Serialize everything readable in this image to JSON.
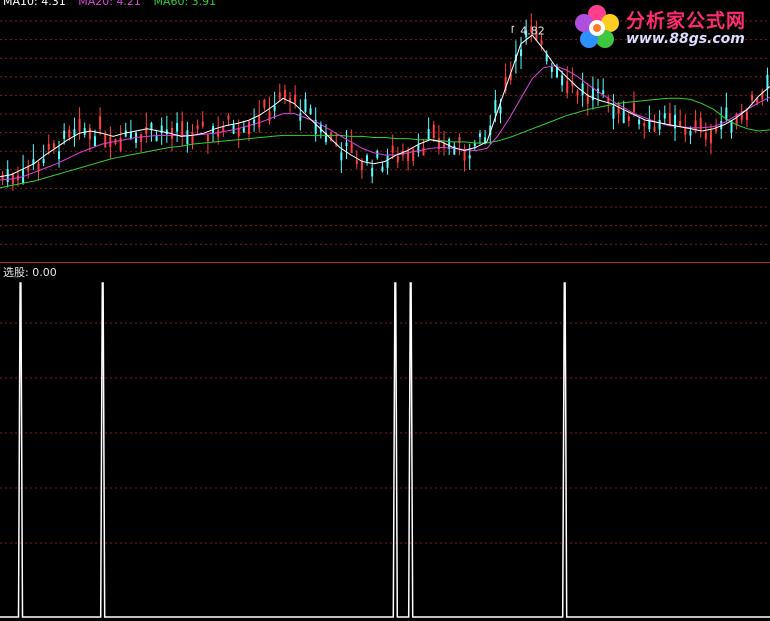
{
  "legend": {
    "ma10_label": "MA10: 4.31",
    "ma20_label": "MA20: 4.21",
    "ma60_label": "MA60: 3.91"
  },
  "colors": {
    "ma10": "#ffffff",
    "ma20": "#e040e0",
    "ma60": "#30d030",
    "candle_up": "#ff4040",
    "candle_down": "#54ffff",
    "grid": "#8a1a1a",
    "divider": "#c02020",
    "signal": "#ffffff"
  },
  "watermark": {
    "title": "分析家公式网",
    "url": "www.88gs.com"
  },
  "chart_data": [
    {
      "type": "candlestick",
      "title": "",
      "annotations": [
        {
          "text": "4.82",
          "label": "high"
        }
      ],
      "y_range": [
        2.9,
        4.9
      ],
      "grid": true,
      "series": [
        {
          "name": "MA10",
          "values": [
            3.48,
            3.5,
            3.55,
            3.6,
            3.68,
            3.75,
            3.82,
            3.88,
            3.9,
            3.88,
            3.85,
            3.88,
            3.9,
            3.92,
            3.9,
            3.88,
            3.85,
            3.86,
            3.88,
            3.92,
            3.95,
            3.97,
            4.0,
            4.05,
            4.12,
            4.2,
            4.15,
            4.05,
            3.95,
            3.85,
            3.75,
            3.68,
            3.62,
            3.6,
            3.62,
            3.68,
            3.72,
            3.78,
            3.82,
            3.8,
            3.75,
            3.72,
            3.75,
            3.8,
            4.1,
            4.4,
            4.7,
            4.78,
            4.65,
            4.5,
            4.4,
            4.3,
            4.22,
            4.18,
            4.15,
            4.1,
            4.05,
            4.0,
            3.98,
            3.96,
            3.94,
            3.92,
            3.9,
            3.92,
            3.96,
            4.02,
            4.1,
            4.22,
            4.31
          ]
        },
        {
          "name": "MA20",
          "values": [
            3.45,
            3.46,
            3.48,
            3.52,
            3.56,
            3.6,
            3.65,
            3.7,
            3.74,
            3.78,
            3.8,
            3.82,
            3.84,
            3.85,
            3.86,
            3.86,
            3.86,
            3.86,
            3.87,
            3.88,
            3.9,
            3.92,
            3.95,
            3.98,
            4.02,
            4.06,
            4.06,
            4.02,
            3.98,
            3.92,
            3.86,
            3.8,
            3.74,
            3.7,
            3.68,
            3.68,
            3.7,
            3.72,
            3.74,
            3.75,
            3.74,
            3.73,
            3.72,
            3.74,
            3.86,
            4.02,
            4.2,
            4.38,
            4.48,
            4.5,
            4.46,
            4.4,
            4.32,
            4.25,
            4.18,
            4.12,
            4.06,
            4.02,
            3.98,
            3.95,
            3.94,
            3.93,
            3.93,
            3.94,
            3.98,
            4.04,
            4.1,
            4.16,
            4.21
          ]
        },
        {
          "name": "MA60",
          "values": [
            3.38,
            3.4,
            3.42,
            3.44,
            3.47,
            3.5,
            3.53,
            3.56,
            3.59,
            3.62,
            3.65,
            3.67,
            3.69,
            3.71,
            3.73,
            3.75,
            3.76,
            3.78,
            3.79,
            3.8,
            3.81,
            3.82,
            3.83,
            3.84,
            3.85,
            3.86,
            3.86,
            3.86,
            3.86,
            3.86,
            3.86,
            3.85,
            3.85,
            3.84,
            3.84,
            3.83,
            3.83,
            3.82,
            3.82,
            3.81,
            3.8,
            3.8,
            3.79,
            3.79,
            3.81,
            3.84,
            3.88,
            3.92,
            3.96,
            4.0,
            4.04,
            4.07,
            4.1,
            4.12,
            4.14,
            4.16,
            4.17,
            4.18,
            4.19,
            4.2,
            4.2,
            4.19,
            4.15,
            4.1,
            4.02,
            3.96,
            3.92,
            3.9,
            3.91
          ]
        }
      ]
    },
    {
      "type": "line",
      "title": "选股: 0.00",
      "series": [
        {
          "name": "选股",
          "signal_bars": [
            4,
            20,
            77,
            80,
            110
          ]
        }
      ],
      "y_range": [
        0,
        1
      ],
      "grid": true
    }
  ]
}
